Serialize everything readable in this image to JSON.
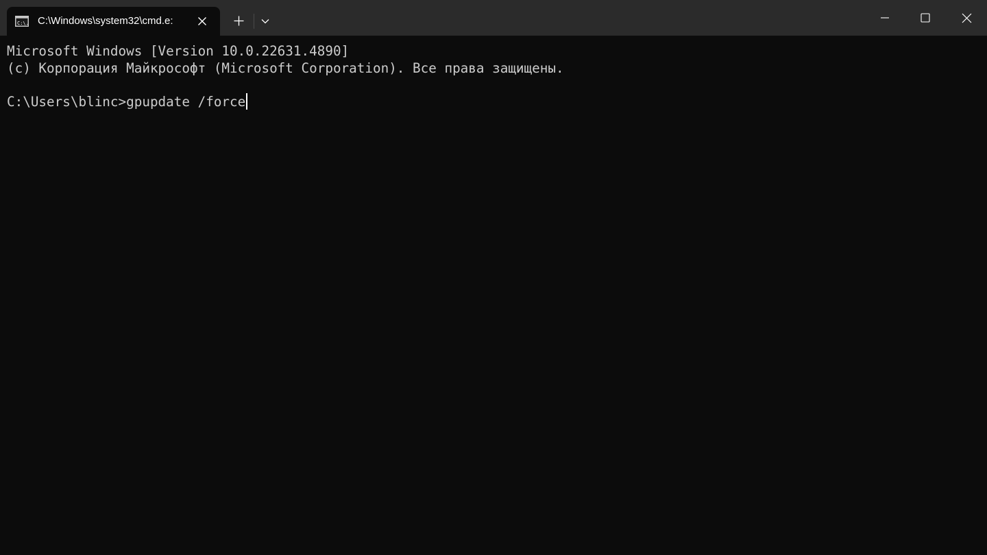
{
  "tab": {
    "title": "C:\\Windows\\system32\\cmd.e:",
    "icon": "cmd-icon",
    "icon_text": "C:\\."
  },
  "titlebar": {
    "new_tab_icon": "plus-icon",
    "dropdown_icon": "chevron-down-icon",
    "minimize_icon": "minimize-icon",
    "maximize_icon": "maximize-icon",
    "close_icon": "close-icon"
  },
  "console": {
    "lines": [
      "Microsoft Windows [Version 10.0.22631.4890]",
      "(c) Корпорация Майкрософт (Microsoft Corporation). Все права защищены."
    ],
    "prompt": "C:\\Users\\blinc>",
    "command": "gpupdate /force"
  },
  "colors": {
    "console_bg": "#0c0c0c",
    "titlebar_bg": "#2b2b2b",
    "text": "#cccccc"
  }
}
